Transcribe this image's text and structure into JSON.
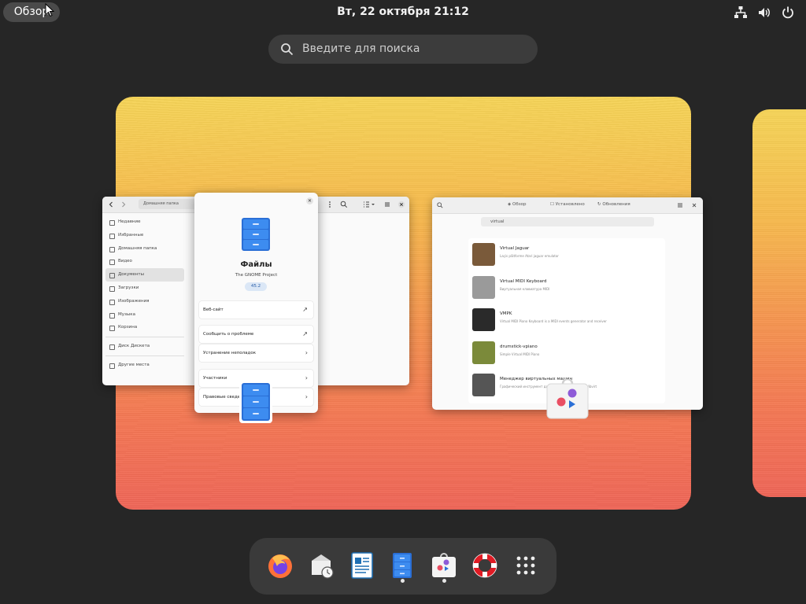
{
  "topbar": {
    "activities_label": "Обзор",
    "clock": "Вт, 22 октября  21:12",
    "tray_icons": [
      "network-icon",
      "volume-icon",
      "power-icon"
    ]
  },
  "search": {
    "placeholder": "Введите для поиска"
  },
  "files_window": {
    "path": "Домашняя папка",
    "sidebar_items": [
      {
        "label": "Недавние",
        "icon": "clock-icon"
      },
      {
        "label": "Избранные",
        "icon": "star-icon"
      },
      {
        "label": "Домашняя папка",
        "icon": "home-icon"
      },
      {
        "label": "Видео",
        "icon": "video-icon"
      },
      {
        "label": "Документы",
        "icon": "document-icon",
        "active": true
      },
      {
        "label": "Загрузки",
        "icon": "download-icon"
      },
      {
        "label": "Изображения",
        "icon": "image-icon"
      },
      {
        "label": "Музыка",
        "icon": "music-icon"
      },
      {
        "label": "Корзина",
        "icon": "trash-icon"
      },
      {
        "label": "Диск Дискета",
        "icon": "drive-icon"
      },
      {
        "label": "Другие места",
        "icon": "plus-icon"
      }
    ]
  },
  "about_dialog": {
    "app_name": "Файлы",
    "author": "The GNOME Project",
    "version": "45.2",
    "rows": [
      {
        "label": "Веб-сайт",
        "icon": "external-link-icon"
      },
      {
        "label": "Сообщить о проблеме",
        "icon": "external-link-icon"
      },
      {
        "label": "Устранение неполадок",
        "icon": "chevron-right-icon"
      },
      {
        "label": "Участники",
        "icon": "chevron-right-icon"
      },
      {
        "label": "Правовые сведения",
        "icon": "chevron-right-icon"
      }
    ]
  },
  "software_window": {
    "tabs": [
      "Обзор",
      "Установлено",
      "Обновления"
    ],
    "search_value": "virtual",
    "results": [
      {
        "name": "Virtual Jaguar",
        "desc": "Laçis plätforme Atari jaguar emulator",
        "color": "#7a5a3a"
      },
      {
        "name": "Virtual MIDI Keyboard",
        "desc": "Виртуальная клавиатура MIDI",
        "color": "#9a9a9a"
      },
      {
        "name": "VMPK",
        "desc": "Virtual MIDI Piano Keyboard is a MIDI events generator and receiver",
        "color": "#2a2a2a"
      },
      {
        "name": "drumstick-vpiano",
        "desc": "Simple Virtual MIDI Piano",
        "color": "#7b8a3a"
      },
      {
        "name": "Менеджер виртуальных машин",
        "desc": "Графический инструмент для управления ВМ через libvirt",
        "color": "#555555"
      }
    ]
  },
  "dock": {
    "apps": [
      {
        "name": "Firefox",
        "icon": "firefox-icon",
        "running": false
      },
      {
        "name": "Evolution",
        "icon": "mail-clock-icon",
        "running": false
      },
      {
        "name": "LibreOffice Writer",
        "icon": "writer-icon",
        "running": false
      },
      {
        "name": "Файлы",
        "icon": "files-icon",
        "running": true
      },
      {
        "name": "Приложения",
        "icon": "software-icon",
        "running": true
      },
      {
        "name": "Справка",
        "icon": "help-icon",
        "running": false
      },
      {
        "name": "Показать приложения",
        "icon": "app-grid-icon",
        "running": false
      }
    ]
  }
}
